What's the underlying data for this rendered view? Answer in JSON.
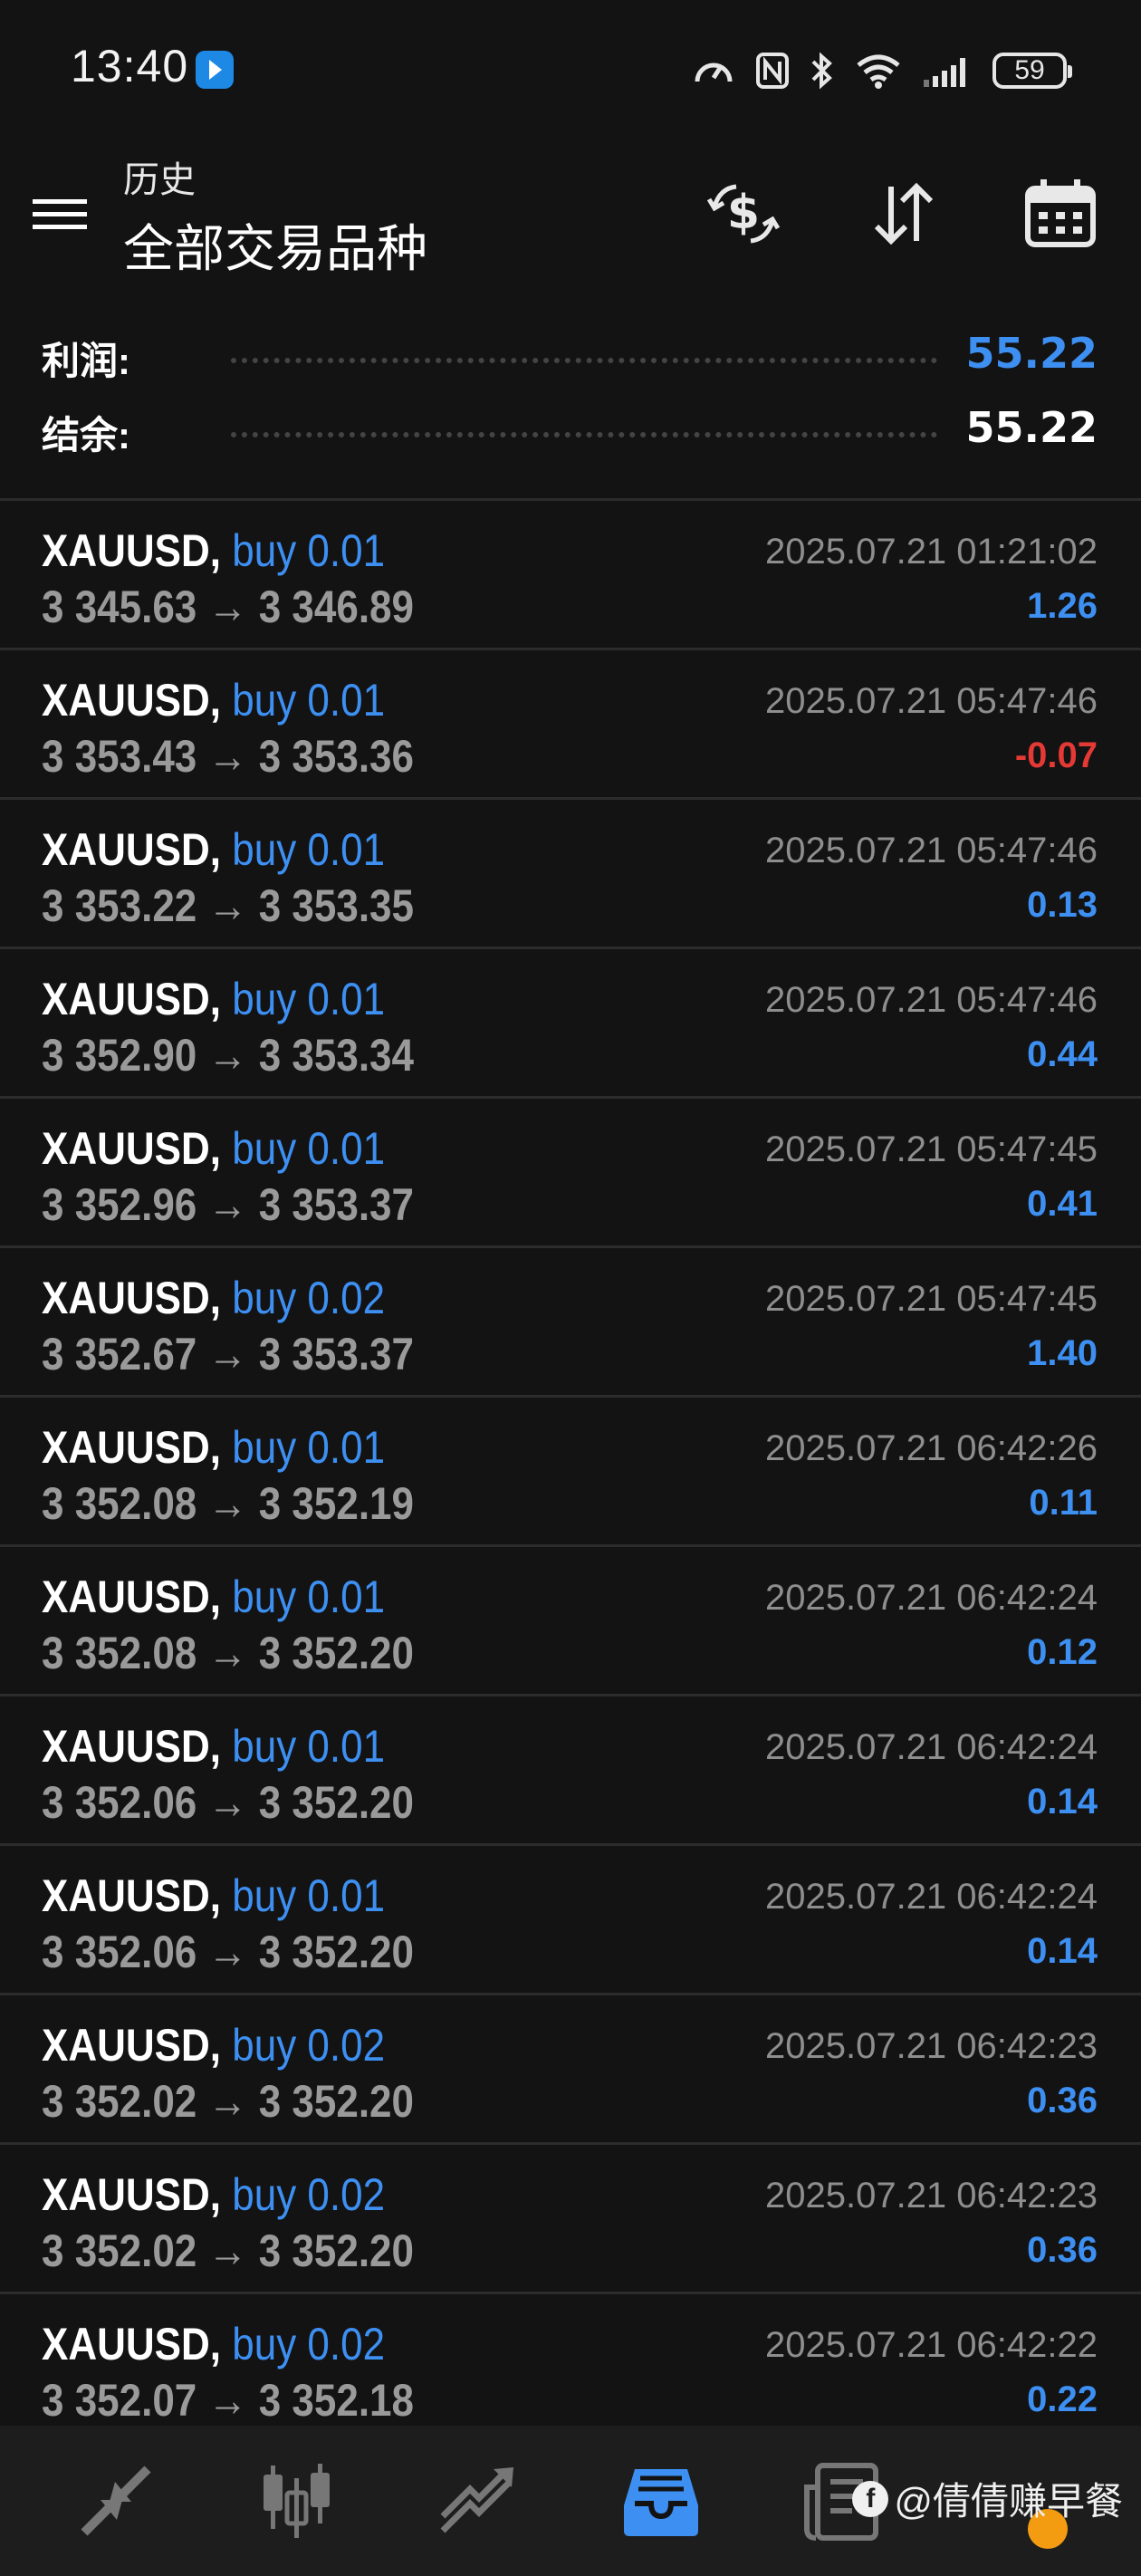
{
  "status_bar": {
    "time": "13:40",
    "battery": "59"
  },
  "header": {
    "subtitle": "历史",
    "title": "全部交易品种"
  },
  "summary": {
    "profit_label": "利润:",
    "profit_value": "55.22",
    "balance_label": "结余:",
    "balance_value": "55.22"
  },
  "trades": [
    {
      "symbol": "XAUUSD,",
      "side": "buy 0.01",
      "prices": "3 345.63 → 3 346.89",
      "time": "2025.07.21 01:21:02",
      "profit": "1.26",
      "positive": true
    },
    {
      "symbol": "XAUUSD,",
      "side": "buy 0.01",
      "prices": "3 353.43 → 3 353.36",
      "time": "2025.07.21 05:47:46",
      "profit": "-0.07",
      "positive": false
    },
    {
      "symbol": "XAUUSD,",
      "side": "buy 0.01",
      "prices": "3 353.22 → 3 353.35",
      "time": "2025.07.21 05:47:46",
      "profit": "0.13",
      "positive": true
    },
    {
      "symbol": "XAUUSD,",
      "side": "buy 0.01",
      "prices": "3 352.90 → 3 353.34",
      "time": "2025.07.21 05:47:46",
      "profit": "0.44",
      "positive": true
    },
    {
      "symbol": "XAUUSD,",
      "side": "buy 0.01",
      "prices": "3 352.96 → 3 353.37",
      "time": "2025.07.21 05:47:45",
      "profit": "0.41",
      "positive": true
    },
    {
      "symbol": "XAUUSD,",
      "side": "buy 0.02",
      "prices": "3 352.67 → 3 353.37",
      "time": "2025.07.21 05:47:45",
      "profit": "1.40",
      "positive": true
    },
    {
      "symbol": "XAUUSD,",
      "side": "buy 0.01",
      "prices": "3 352.08 → 3 352.19",
      "time": "2025.07.21 06:42:26",
      "profit": "0.11",
      "positive": true
    },
    {
      "symbol": "XAUUSD,",
      "side": "buy 0.01",
      "prices": "3 352.08 → 3 352.20",
      "time": "2025.07.21 06:42:24",
      "profit": "0.12",
      "positive": true
    },
    {
      "symbol": "XAUUSD,",
      "side": "buy 0.01",
      "prices": "3 352.06 → 3 352.20",
      "time": "2025.07.21 06:42:24",
      "profit": "0.14",
      "positive": true
    },
    {
      "symbol": "XAUUSD,",
      "side": "buy 0.01",
      "prices": "3 352.06 → 3 352.20",
      "time": "2025.07.21 06:42:24",
      "profit": "0.14",
      "positive": true
    },
    {
      "symbol": "XAUUSD,",
      "side": "buy 0.02",
      "prices": "3 352.02 → 3 352.20",
      "time": "2025.07.21 06:42:23",
      "profit": "0.36",
      "positive": true
    },
    {
      "symbol": "XAUUSD,",
      "side": "buy 0.02",
      "prices": "3 352.02 → 3 352.20",
      "time": "2025.07.21 06:42:23",
      "profit": "0.36",
      "positive": true
    },
    {
      "symbol": "XAUUSD,",
      "side": "buy 0.02",
      "prices": "3 352.07 → 3 352.18",
      "time": "2025.07.21 06:42:22",
      "profit": "0.22",
      "positive": true
    }
  ],
  "icons": {
    "menu": "menu-icon",
    "currency": "currency-exchange-icon",
    "sort": "sort-icon",
    "calendar": "calendar-icon",
    "nav_quotes": "quotes-icon",
    "nav_chart": "candlestick-chart-icon",
    "nav_trade": "trade-icon",
    "nav_history": "history-inbox-icon",
    "nav_news": "news-icon"
  },
  "watermark": "@倩倩赚早餐",
  "colors": {
    "background": "#131313",
    "accent_blue": "#3d8ff2",
    "loss_red": "#e53935",
    "price_gray": "#9a9a9a"
  }
}
